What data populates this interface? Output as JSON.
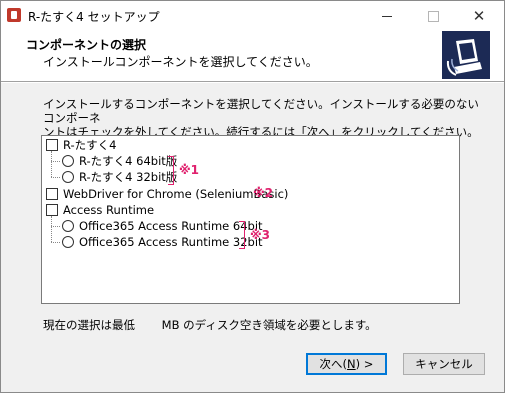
{
  "window": {
    "title": "R-たすく4 セットアップ"
  },
  "header": {
    "title": "コンポーネントの選択",
    "subtitle": "インストールコンポーネントを選択してください。"
  },
  "description": {
    "line1": "インストールするコンポーネントを選択してください。インストールする必要のないコンポーネ",
    "line2": "ントはチェックを外してください。続行するには「次へ」をクリックしてください。"
  },
  "components": {
    "item1": {
      "label": "R-たすく4",
      "checked": false
    },
    "item1_opt1": {
      "label": "R-たすく4 64bit版",
      "selected": false
    },
    "item1_opt2": {
      "label": "R-たすく4 32bit版",
      "selected": false
    },
    "item2": {
      "label": "WebDriver for Chrome (SeleniumBasic)",
      "checked": false
    },
    "item3": {
      "label": "Access Runtime",
      "checked": false
    },
    "item3_opt1": {
      "label": "Office365 Access Runtime 64bit",
      "selected": false
    },
    "item3_opt2": {
      "label": "Office365 Access Runtime 32bit",
      "selected": false
    }
  },
  "annotations": {
    "note1": "※1",
    "note2": "※2",
    "note3": "※3",
    "color": "#e0226e"
  },
  "status_text": "現在の選択は最低 　　MB のディスク空き領域を必要とします。",
  "buttons": {
    "next_prefix": "次へ(",
    "next_key": "N",
    "next_suffix": ") >",
    "cancel": "キャンセル"
  },
  "icons": {
    "app": "installer-app-icon",
    "header": "computer-install-icon",
    "minimize": "minimize-icon",
    "maximize": "maximize-icon",
    "close": "close-icon"
  }
}
